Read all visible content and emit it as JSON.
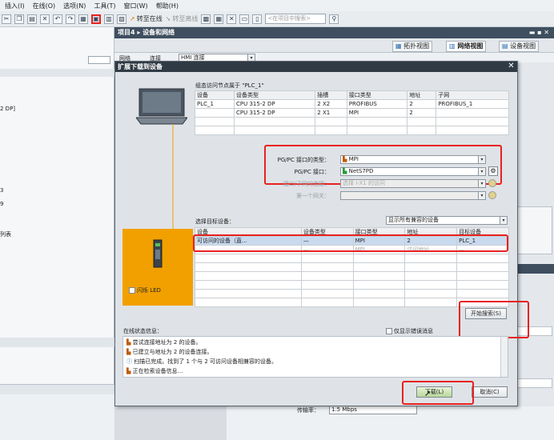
{
  "menu": [
    "插入(I)",
    "在线(O)",
    "选项(N)",
    "工具(T)",
    "窗口(W)",
    "帮助(H)"
  ],
  "toolbar": {
    "goOnline": "转至在线",
    "goOffline": "转至离线",
    "searchPlaceholder": "<在项目中搜索>"
  },
  "project": {
    "breadcrumb": "项目4 ▸ 设备和网络",
    "tabs": [
      "拓扑视图",
      "网络视图",
      "设备视图"
    ]
  },
  "leftPanel": {
    "items": [
      "2 DP]",
      "3",
      "9",
      "列表"
    ]
  },
  "netbar": {
    "network": "网络",
    "connection": "连接",
    "connType": "HMI 连接"
  },
  "dialog": {
    "title": "扩展下载到设备",
    "configuredNodesLabel": "组态访问节点属于 \"PLC_1\"",
    "configuredTable": {
      "headers": [
        "设备",
        "设备类型",
        "插槽",
        "接口类型",
        "地址",
        "子网"
      ],
      "rows": [
        [
          "PLC_1",
          "CPU 315-2 DP",
          "2 X2",
          "PROFIBUS",
          "2",
          "PROFIBUS_1"
        ],
        [
          "",
          "CPU 315-2 DP",
          "2 X1",
          "MPI",
          "2",
          ""
        ]
      ]
    },
    "pgpcInterfaceTypeLabel": "PG/PC 接口的类型：",
    "pgpcInterfaceType": "MPI",
    "pgpcInterfaceLabel": "PG/PC 接口：",
    "pgpcInterface": "NetS7PD",
    "subnetConnLabel": "接口/子网的连接：",
    "subnetConn": "选择 I-X1 的访问",
    "firstGatewayLabel": "第一个网关：",
    "selectTargetLabel": "选择目标设备：",
    "targetFilter": "显示所有兼容的设备",
    "targetTable": {
      "headers": [
        "设备",
        "设备类型",
        "接口类型",
        "地址",
        "目标设备"
      ],
      "rows": [
        [
          "可访问的设备（直...",
          "—",
          "MPI",
          "2",
          "PLC_1"
        ],
        [
          "",
          "—",
          "MPI",
          "访问地址",
          "—"
        ]
      ]
    },
    "flashLed": "闪烁 LED",
    "startSearch": "开始搜索(S)",
    "onlineStatusLabel": "在线状态信息：",
    "showErrorsOnly": "仅显示错误消息",
    "messages": [
      "尝试连接地址为 2 的设备。",
      "已建立与地址为 2 的设备连接。",
      "扫描已完成。找到了 1 个与 2 可访问设备相兼容的设备。",
      "正在检索设备信息..."
    ],
    "loadButton": "下载(L)",
    "cancelButton": "取消(C)"
  },
  "bottom": {
    "baudLabel": "传输率：",
    "baudValue": "1.5 Mbps"
  },
  "colors": {
    "highlight": "#e8211f",
    "orange": "#f2a000",
    "titlebar": "#2f3a44"
  }
}
